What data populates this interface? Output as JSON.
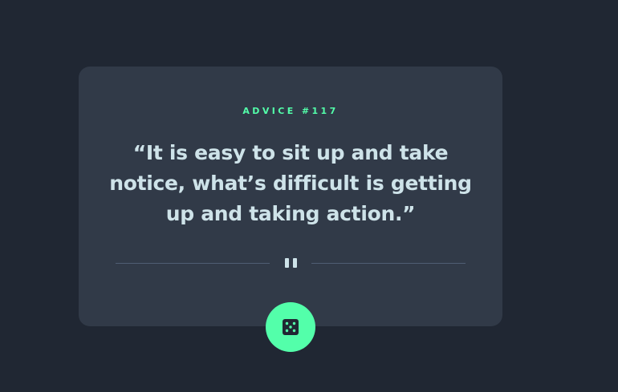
{
  "advice": {
    "label": "ADVICE #117",
    "quote": "“It is easy to sit up and take notice, what’s difficult is getting up and taking action.”"
  },
  "icons": {
    "divider": "pause-icon",
    "button": "dice-icon"
  },
  "colors": {
    "background": "#202733",
    "card": "#313a48",
    "accent": "#53ffaa",
    "text": "#cee3e9",
    "divider": "#4f5d74"
  }
}
